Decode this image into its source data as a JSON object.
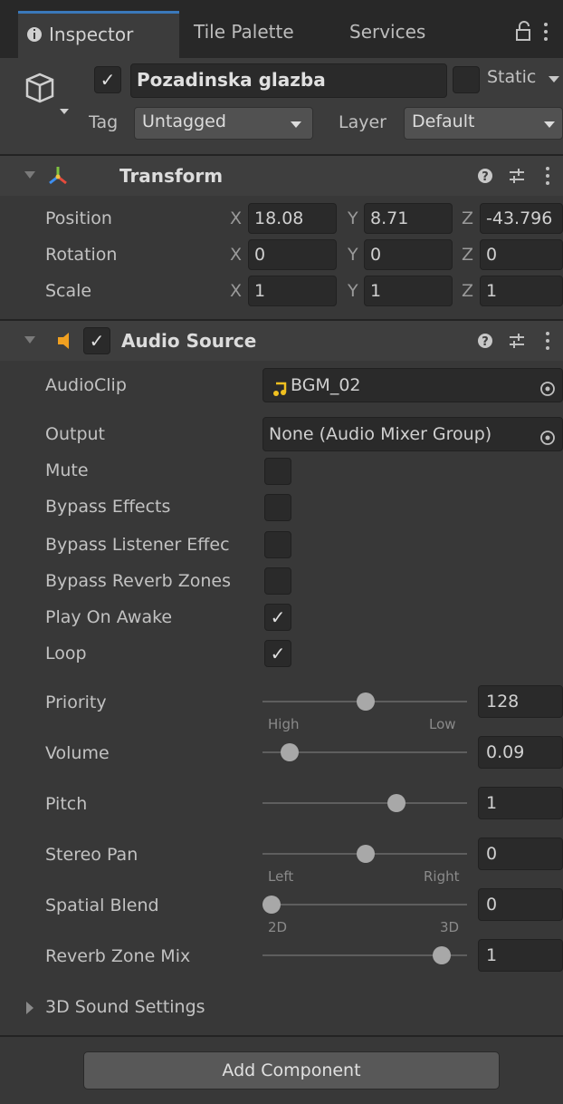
{
  "tabs": {
    "inspector": "Inspector",
    "tile_palette": "Tile Palette",
    "services": "Services"
  },
  "gameobject": {
    "name": "Pozadinska glazba",
    "static_label": "Static",
    "tag_label": "Tag",
    "tag_value": "Untagged",
    "layer_label": "Layer",
    "layer_value": "Default"
  },
  "transform": {
    "title": "Transform",
    "position_label": "Position",
    "rotation_label": "Rotation",
    "scale_label": "Scale",
    "axis_x": "X",
    "axis_y": "Y",
    "axis_z": "Z",
    "position": {
      "x": "18.08",
      "y": "8.71",
      "z": "-43.796"
    },
    "rotation": {
      "x": "0",
      "y": "0",
      "z": "0"
    },
    "scale": {
      "x": "1",
      "y": "1",
      "z": "1"
    }
  },
  "audio_source": {
    "title": "Audio Source",
    "audioclip_label": "AudioClip",
    "audioclip_value": "BGM_02",
    "output_label": "Output",
    "output_value": "None (Audio Mixer Group)",
    "mute_label": "Mute",
    "bypass_effects_label": "Bypass Effects",
    "bypass_listener_label": "Bypass Listener Effec",
    "bypass_reverb_label": "Bypass Reverb Zones",
    "play_on_awake_label": "Play On Awake",
    "loop_label": "Loop",
    "priority_label": "Priority",
    "priority_value": "128",
    "priority_low_label": "High",
    "priority_high_label": "Low",
    "volume_label": "Volume",
    "volume_value": "0.09",
    "pitch_label": "Pitch",
    "pitch_value": "1",
    "stereo_pan_label": "Stereo Pan",
    "stereo_pan_value": "0",
    "stereo_left_label": "Left",
    "stereo_right_label": "Right",
    "spatial_blend_label": "Spatial Blend",
    "spatial_blend_value": "0",
    "spatial_2d_label": "2D",
    "spatial_3d_label": "3D",
    "reverb_zone_mix_label": "Reverb Zone Mix",
    "reverb_zone_mix_value": "1",
    "sound_settings_label": "3D Sound Settings",
    "checkbox_mark": "✓"
  },
  "add_component_label": "Add Component",
  "accent_colors": {
    "tab_highlight": "#3a79bb",
    "audio_icon": "#f0a020"
  }
}
